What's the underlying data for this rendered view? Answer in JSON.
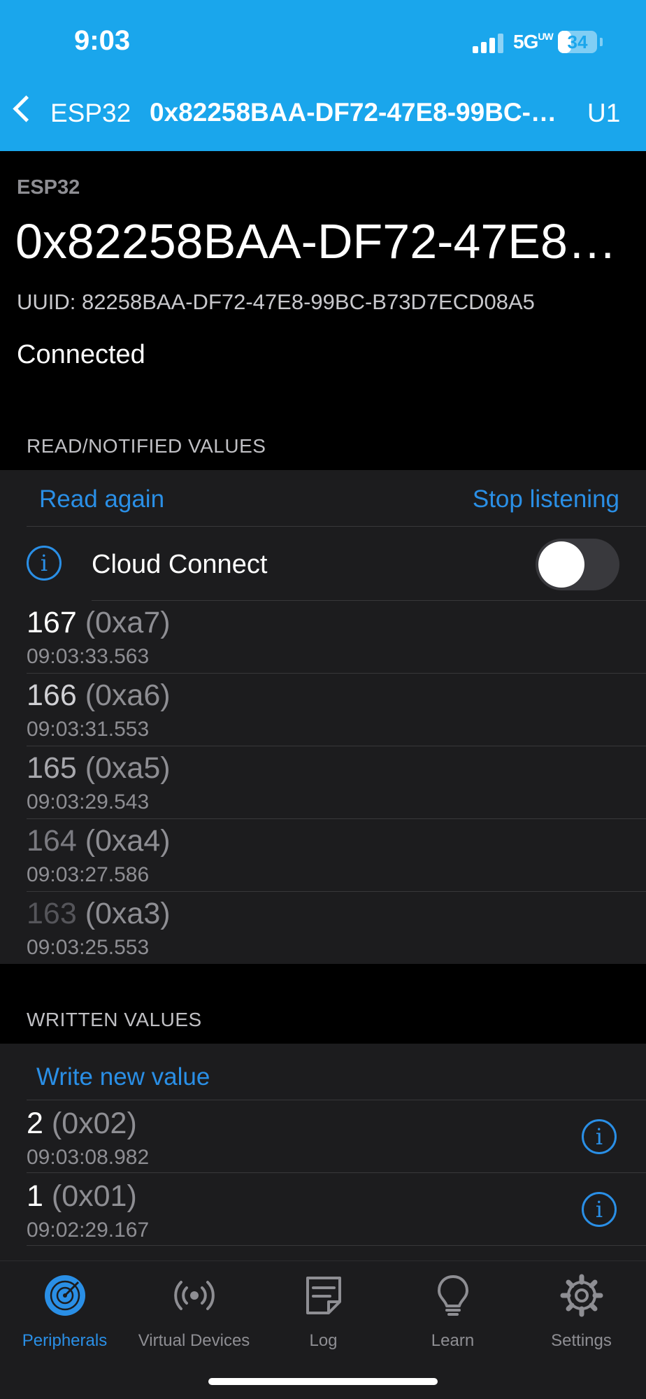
{
  "status_bar": {
    "time": "9:03",
    "network": "5G",
    "network_sup": "UW",
    "battery": "34"
  },
  "nav": {
    "back_label": "ESP32",
    "title": "0x82258BAA-DF72-47E8-99BC-B73D7ECD08A5",
    "right": "U1"
  },
  "header": {
    "device_name": "ESP32",
    "characteristic": "0x82258BAA-DF72-47E8-99BC-B73D7ECD08A5",
    "uuid": "UUID: 82258BAA-DF72-47E8-99BC-B73D7ECD08A5",
    "status": "Connected"
  },
  "read_section": {
    "header": "READ/NOTIFIED VALUES",
    "read_again": "Read again",
    "stop_listening": "Stop listening",
    "cloud_connect": "Cloud Connect",
    "cloud_connect_on": false,
    "values": [
      {
        "value": "167",
        "hex": "(0xa7)",
        "time": "09:03:33.563"
      },
      {
        "value": "166",
        "hex": "(0xa6)",
        "time": "09:03:31.553"
      },
      {
        "value": "165",
        "hex": "(0xa5)",
        "time": "09:03:29.543"
      },
      {
        "value": "164",
        "hex": "(0xa4)",
        "time": "09:03:27.586"
      },
      {
        "value": "163",
        "hex": "(0xa3)",
        "time": "09:03:25.553"
      }
    ]
  },
  "written_section": {
    "header": "WRITTEN VALUES",
    "write_new": "Write new value",
    "values": [
      {
        "value": "2",
        "hex": "(0x02)",
        "time": "09:03:08.982"
      },
      {
        "value": "1",
        "hex": "(0x01)",
        "time": "09:02:29.167"
      }
    ]
  },
  "tabbar": {
    "tabs": [
      {
        "label": "Peripherals",
        "icon": "radar-icon",
        "active": true
      },
      {
        "label": "Virtual Devices",
        "icon": "broadcast-icon",
        "active": false
      },
      {
        "label": "Log",
        "icon": "log-icon",
        "active": false
      },
      {
        "label": "Learn",
        "icon": "lightbulb-icon",
        "active": false
      },
      {
        "label": "Settings",
        "icon": "gear-icon",
        "active": false
      }
    ]
  },
  "colors": {
    "nav_bar": "#1aa6ec",
    "accent": "#2a8fe6",
    "background": "#000000",
    "card": "#1c1c1e"
  }
}
